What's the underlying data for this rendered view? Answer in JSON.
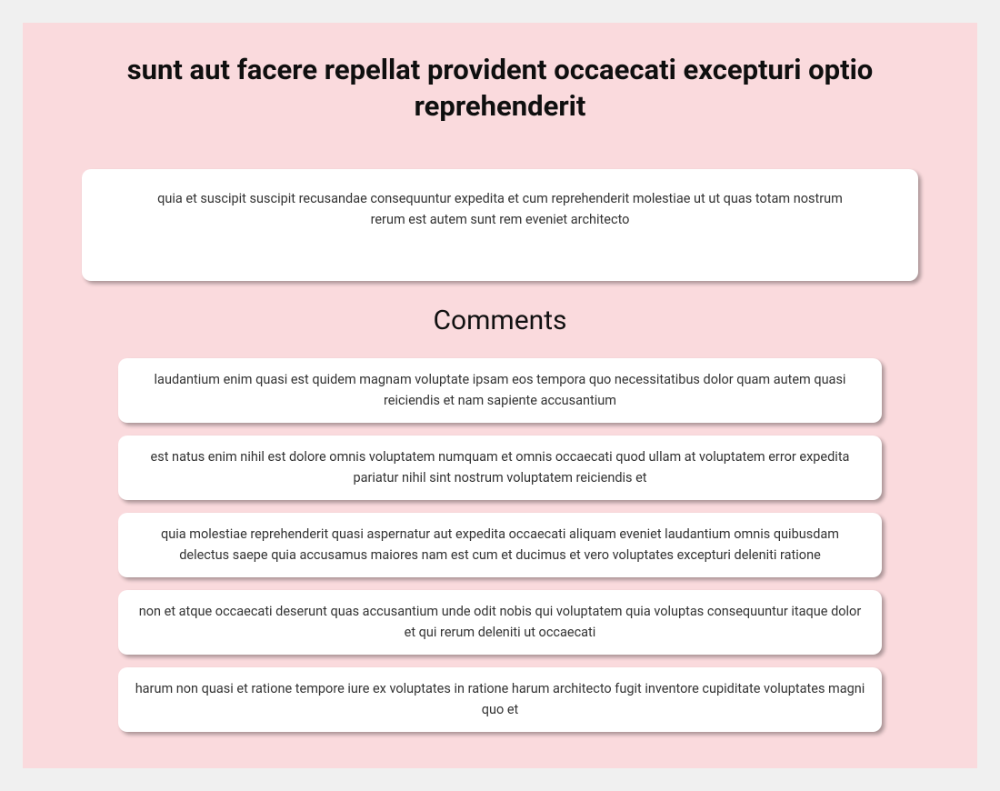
{
  "post": {
    "title": "sunt aut facere repellat provident occaecati excepturi optio reprehenderit",
    "body": "quia et suscipit suscipit recusandae consequuntur expedita et cum reprehenderit molestiae ut ut quas totam nostrum rerum est autem sunt rem eveniet architecto"
  },
  "comments_heading": "Comments",
  "comments": [
    {
      "body": "laudantium enim quasi est quidem magnam voluptate ipsam eos tempora quo necessitatibus dolor quam autem quasi reiciendis et nam sapiente accusantium"
    },
    {
      "body": "est natus enim nihil est dolore omnis voluptatem numquam et omnis occaecati quod ullam at voluptatem error expedita pariatur nihil sint nostrum voluptatem reiciendis et"
    },
    {
      "body": "quia molestiae reprehenderit quasi aspernatur aut expedita occaecati aliquam eveniet laudantium omnis quibusdam delectus saepe quia accusamus maiores nam est cum et ducimus et vero voluptates excepturi deleniti ratione"
    },
    {
      "body": "non et atque occaecati deserunt quas accusantium unde odit nobis qui voluptatem quia voluptas consequuntur itaque dolor et qui rerum deleniti ut occaecati"
    },
    {
      "body": "harum non quasi et ratione tempore iure ex voluptates in ratione harum architecto fugit inventore cupiditate voluptates magni quo et"
    }
  ]
}
